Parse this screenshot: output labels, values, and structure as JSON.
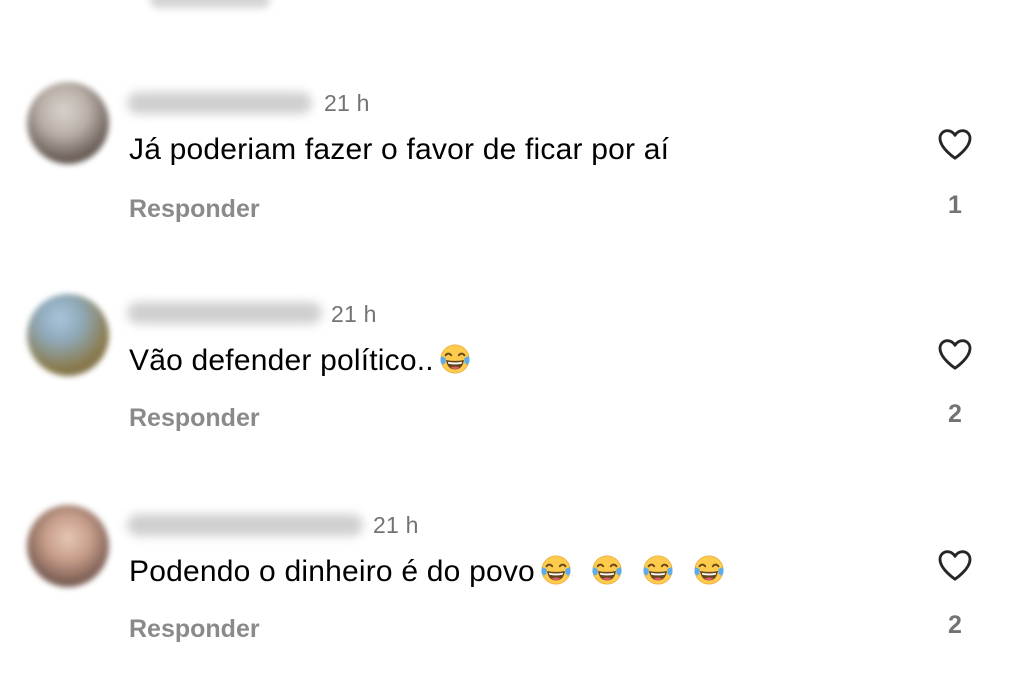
{
  "comments": [
    {
      "time": "21 h",
      "text": "Já poderiam fazer o favor de ficar por aí",
      "emoji_count": 0,
      "reply_label": "Responder",
      "like_count": "1"
    },
    {
      "time": "21 h",
      "text": "Vão defender político..",
      "emoji_count": 1,
      "reply_label": "Responder",
      "like_count": "2"
    },
    {
      "time": "21 h",
      "text": "Podendo o dinheiro é do povo",
      "emoji_count": 4,
      "reply_label": "Responder",
      "like_count": "2"
    }
  ],
  "icons": {
    "like": "heart-outline-icon",
    "reaction": "face-with-tears-of-joy-emoji"
  },
  "colors": {
    "secondary_text": "#737373",
    "primary_text": "#000000",
    "background": "#ffffff"
  }
}
